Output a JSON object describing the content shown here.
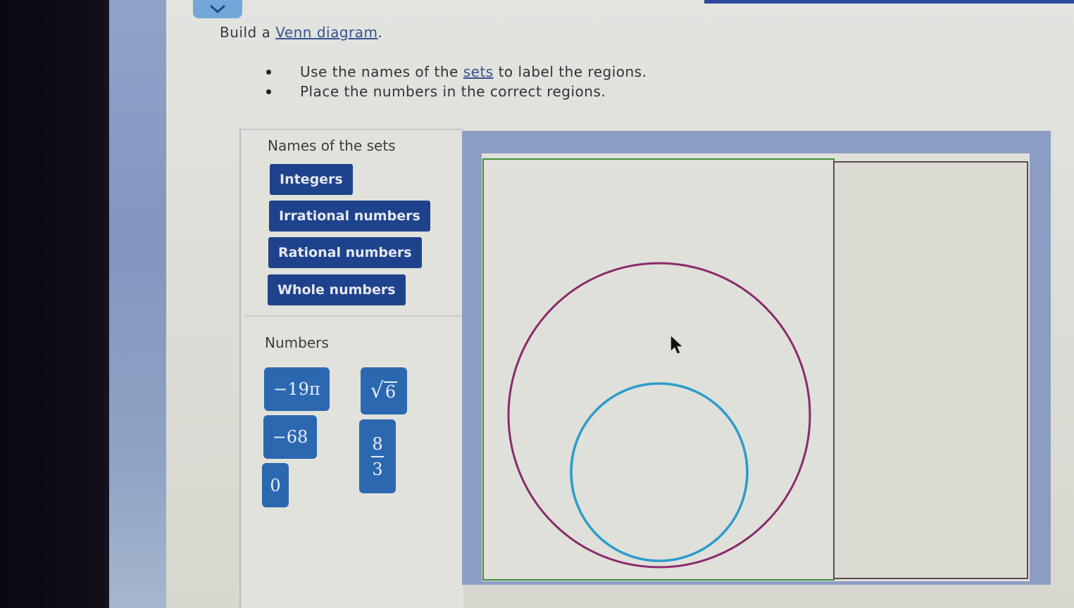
{
  "header": {
    "title_prefix": "Build a ",
    "title_link": "Venn diagram",
    "title_suffix": "."
  },
  "instructions": [
    {
      "before": "Use the names of the ",
      "link": "sets",
      "after": " to label the regions."
    },
    {
      "text": "Place the numbers in the correct regions."
    }
  ],
  "sets_panel": {
    "heading": "Names of the sets",
    "chips": [
      "Integers",
      "Irrational numbers",
      "Rational numbers",
      "Whole numbers"
    ]
  },
  "numbers_panel": {
    "heading": "Numbers",
    "chips": {
      "neg19pi": "−19π",
      "sqrt6_radicand": "6",
      "neg68": "−68",
      "frac_num": "8",
      "frac_den": "3",
      "zero": "0"
    }
  },
  "venn": {
    "regions": [
      "outer-left-region",
      "outer-circle",
      "inner-circle",
      "right-region"
    ],
    "colors": {
      "frame": "#8c9dc4",
      "outer_circle": "#8a2a6a",
      "inner_circle": "#2a9ccb",
      "left_border": "#3f8f3a",
      "right_border": "#5a4a50"
    }
  },
  "colors": {
    "set_chip": "#1e428c",
    "number_chip": "#2c68b0",
    "link": "#35538f"
  }
}
